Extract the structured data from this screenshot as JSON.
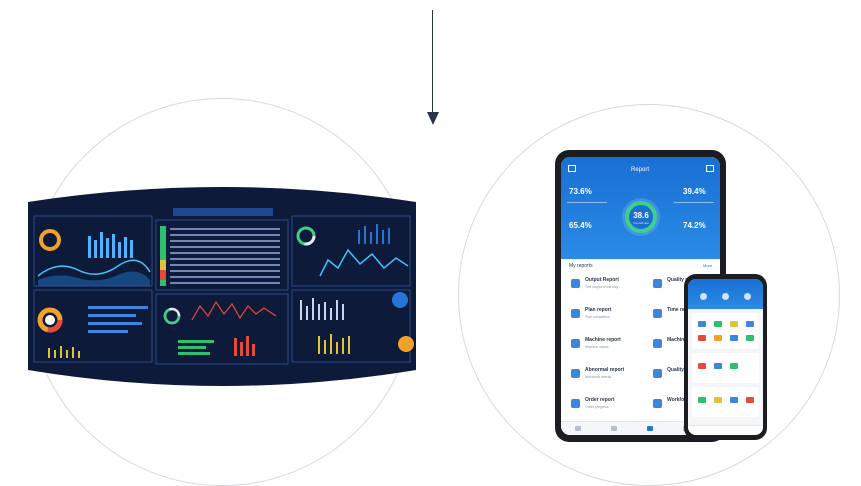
{
  "tablet": {
    "header_title": "Report",
    "gauge_value": "38.6",
    "gauge_label": "Overall rate",
    "corner_values": [
      "73.6%",
      "39.4%",
      "65.4%",
      "74.2%"
    ],
    "section_title": "My reports",
    "section_more": "More",
    "reports": [
      {
        "title": "Output Report",
        "sub": "The output of the day"
      },
      {
        "title": "Plan report",
        "sub": "Plan completion"
      },
      {
        "title": "Machine report",
        "sub": "Machine status"
      },
      {
        "title": "Abnormal report",
        "sub": "Abnormal events"
      },
      {
        "title": "Order report",
        "sub": "Order progress"
      }
    ],
    "reports_right": [
      "Quality report",
      "Time report",
      "Machine report",
      "Quality report",
      "Workforce report"
    ]
  },
  "colors": {
    "brand_blue": "#1e7ad8",
    "dashboard_bg": "#0e1a3a",
    "gauge_green": "#3ecf8e"
  }
}
